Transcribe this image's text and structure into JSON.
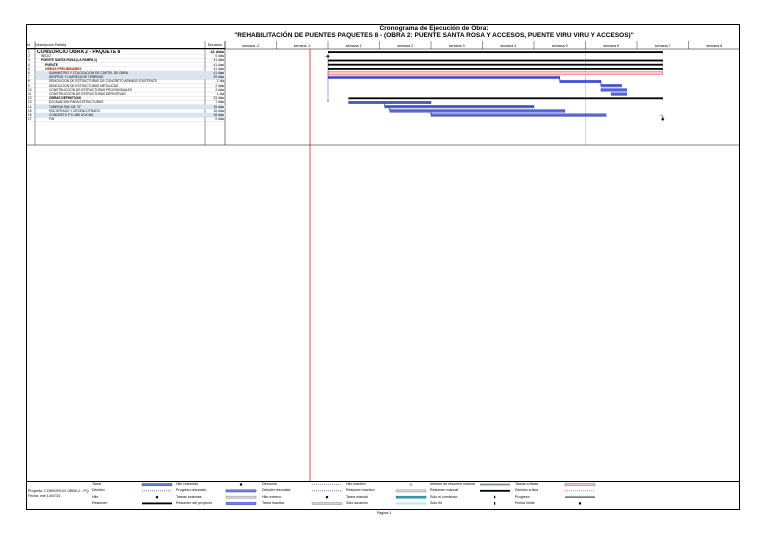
{
  "title_line1": "Cronograma de Ejecución de Obra:",
  "title_line2": "\"REHABILITACIÓN DE PUENTES PAQUETES 8 - (OBRA 2: PUENTE SANTA ROSA Y ACCESOS, PUENTE VIRU VIRU Y ACCESOS)\"",
  "header": {
    "id": "Id",
    "task_name": "Descripción Partida",
    "duration": "Duración",
    "weeks": [
      "semana -2",
      "semana -1",
      "semana 1",
      "semana 2",
      "semana 3",
      "semana 4",
      "semana 5",
      "semana 6",
      "semana 7",
      "semana 8"
    ]
  },
  "tasks": [
    {
      "id": "1",
      "name": "CONSORCIO OBRA 2 - PAQUETE 8",
      "duration": "41 días",
      "start": 0.0,
      "end": 6.5,
      "kind": "summary"
    },
    {
      "id": "2",
      "name": "INICIO",
      "duration": "0 días",
      "start": 0.0,
      "end": 0.0,
      "kind": "milestone"
    },
    {
      "id": "3",
      "name": "PUENTE SANTA ROSA (LA PAMPA 1)",
      "duration": "41 días",
      "start": 0.0,
      "end": 6.5,
      "kind": "summary"
    },
    {
      "id": "4",
      "name": "PUENTE",
      "duration": "41 días",
      "start": 0.0,
      "end": 6.5,
      "kind": "summary"
    },
    {
      "id": "5",
      "name": "OBRAS PRELIMINARES",
      "duration": "41 días",
      "start": 0.0,
      "end": 6.5,
      "kind": "critical-summary"
    },
    {
      "id": "6",
      "name": "SUMINISTRO Y COLOCACION DE CARTEL DE OBRA",
      "duration": "41 días",
      "start": 0.0,
      "end": 6.5,
      "kind": "critical"
    },
    {
      "id": "7",
      "name": "DESPEJE Y LIMPIEZA DE TERRENO",
      "duration": "29 días",
      "start": 0.0,
      "end": 4.5,
      "kind": "task"
    },
    {
      "id": "8",
      "name": "DEMOLICION DE ESTRUCTURAS DE CONCRETO ARMADO EXISTENTE",
      "duration": "1 día",
      "start": 4.5,
      "end": 5.3,
      "kind": "task"
    },
    {
      "id": "9",
      "name": "DEMOLICION DE ESTRUCTURAS METALICAS",
      "duration": "2 días",
      "start": 5.3,
      "end": 5.7,
      "kind": "task"
    },
    {
      "id": "10",
      "name": "CONSTRUCCION DE ESTRUCTURAS PROVISIONALES",
      "duration": "2 días",
      "start": 5.3,
      "end": 5.8,
      "kind": "task"
    },
    {
      "id": "11",
      "name": "CONSTRUCCION DE ESTRUCTURAS DEFINITIVAS",
      "duration": "1 día",
      "start": 5.5,
      "end": 5.8,
      "kind": "task"
    },
    {
      "id": "12",
      "name": "OBRAS DEFINITIVAS",
      "duration": "33 días",
      "start": 0.4,
      "end": 6.5,
      "kind": "summary"
    },
    {
      "id": "13",
      "name": "EXCAVACION PARA ESTRUCTURAS",
      "duration": "7 días",
      "start": 0.4,
      "end": 2.0,
      "kind": "task"
    },
    {
      "id": "14",
      "name": "TUBERIA TMC DE 72\"",
      "duration": "15 días",
      "start": 1.1,
      "end": 4.0,
      "kind": "task"
    },
    {
      "id": "15",
      "name": "ENCOFRADO Y DESENCOFRADO",
      "duration": "15 días",
      "start": 1.2,
      "end": 4.6,
      "kind": "task"
    },
    {
      "id": "16",
      "name": "CONCRETO F'C=280 KG/CM2",
      "duration": "18 días",
      "start": 2.0,
      "end": 5.4,
      "kind": "task"
    },
    {
      "id": "17",
      "name": "FIN",
      "duration": "0 días",
      "start": 6.5,
      "end": 6.5,
      "kind": "milestone"
    }
  ],
  "legend": {
    "project_line1": "Proyecto: CONSORCIO OBRA 2 - PQ",
    "project_line2": "Fecha: mié 14/07/21",
    "items": [
      [
        "Tarea",
        "División",
        "Hito",
        "Resumen"
      ],
      [
        "Hito resumido",
        "Progreso resumido",
        "Tareas externas",
        "Resumen del proyecto"
      ],
      [
        "Dirección",
        "División resumida",
        "Hito externo",
        "Tarea inactiva"
      ],
      [
        "Hito inactivo",
        "Resumen inactivo",
        "Tarea manual",
        "Sólo duración"
      ],
      [
        "Informe de resumen manual",
        "Resumen manual",
        "Sólo el comienzo",
        "Sólo fin"
      ],
      [
        "Tareas críticas",
        "División crítica",
        "Progreso",
        "Fecha límite"
      ]
    ]
  },
  "footer": "Página 1"
}
